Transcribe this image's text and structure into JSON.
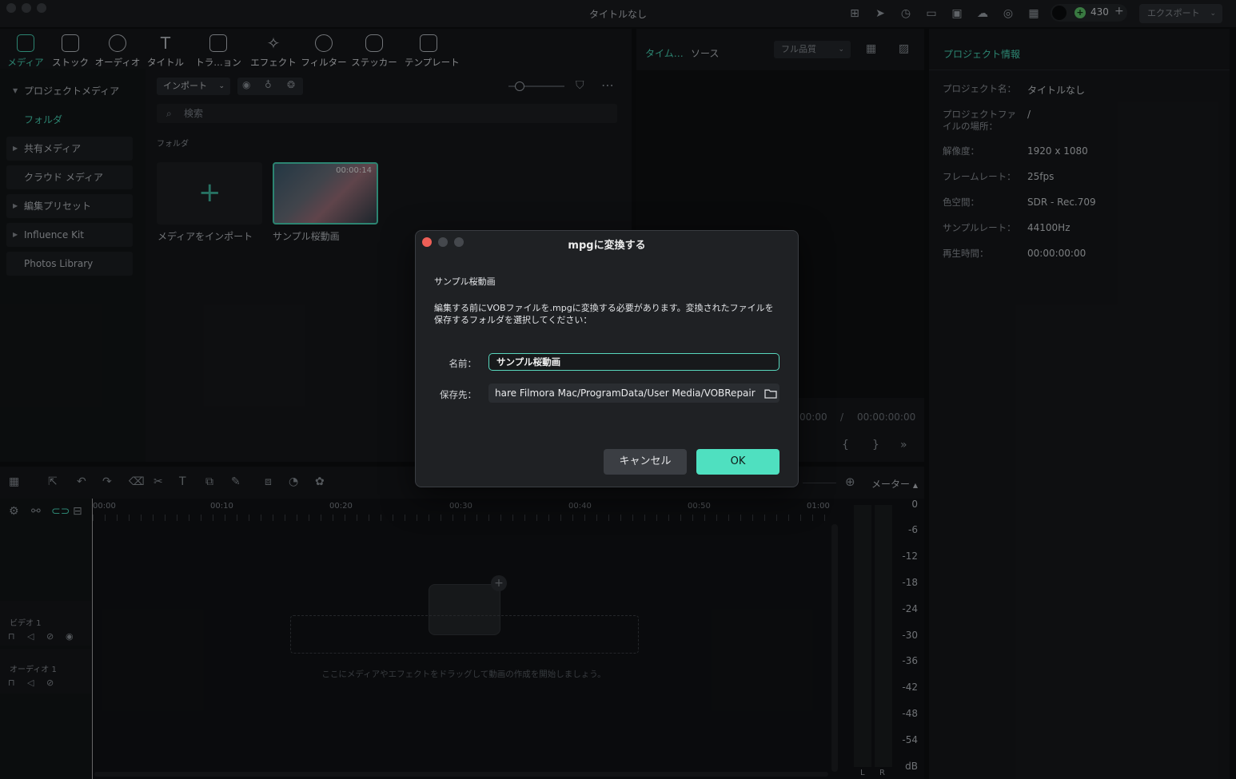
{
  "app": {
    "title": "タイトルなし",
    "credits": "430",
    "export_label": "エクスポート"
  },
  "toolbar": {
    "items": [
      {
        "label": "メディア"
      },
      {
        "label": "ストック"
      },
      {
        "label": "オーディオ"
      },
      {
        "label": "タイトル"
      },
      {
        "label": "トラ…ョン"
      },
      {
        "label": "エフェクト"
      },
      {
        "label": "フィルター"
      },
      {
        "label": "ステッカー"
      },
      {
        "label": "テンプレート"
      }
    ]
  },
  "sidebar": {
    "items": [
      {
        "label": "プロジェクトメディア"
      },
      {
        "label": "フォルダ"
      },
      {
        "label": "共有メディア"
      },
      {
        "label": "クラウド メディア"
      },
      {
        "label": "編集プリセット"
      },
      {
        "label": "Influence Kit"
      },
      {
        "label": "Photos Library"
      }
    ]
  },
  "media": {
    "import_label": "インポート",
    "search_placeholder": "検索",
    "folder_heading": "フォルダ",
    "import_tile_label": "メディアをインポート",
    "clip_label": "サンプル桜動画",
    "clip_duration": "00:00:14"
  },
  "preview": {
    "tab_timeline": "タイム…",
    "tab_source": "ソース",
    "quality": "フル品質",
    "time_current": "00:00",
    "time_separator": "/",
    "time_total": "00:00:00:00"
  },
  "project_info": {
    "title": "プロジェクト情報",
    "rows": [
      {
        "label": "プロジェクト名：",
        "value": "タイトルなし"
      },
      {
        "label": "プロジェクトファイルの場所：",
        "value": "/"
      },
      {
        "label": "解像度：",
        "value": "1920 x 1080"
      },
      {
        "label": "フレームレート：",
        "value": "25fps"
      },
      {
        "label": "色空間：",
        "value": "SDR - Rec.709"
      },
      {
        "label": "サンプルレート：",
        "value": "44100Hz"
      },
      {
        "label": "再生時間：",
        "value": "00:00:00:00"
      }
    ]
  },
  "timeline": {
    "ruler": [
      "00:00",
      "00:10",
      "00:20",
      "00:30",
      "00:40",
      "00:50",
      "01:00"
    ],
    "track_video": "ビデオ 1",
    "track_audio": "オーディオ 1",
    "drop_hint": "ここにメディアやエフェクトをドラッグして動画の作成を開始しましょう。",
    "meter_title": "メーター",
    "meter_scale": [
      "0",
      "-6",
      "-12",
      "-18",
      "-24",
      "-30",
      "-36",
      "-42",
      "-48",
      "-54",
      "dB"
    ],
    "meter_left": "L",
    "meter_right": "R"
  },
  "dialog": {
    "title": "mpgに変換する",
    "file_name": "サンプル桜動画",
    "message": "編集する前にVOBファイルを.mpgに変換する必要があります。変換されたファイルを保存するフォルダを選択してください：",
    "name_label": "名前：",
    "name_value": "サンプル桜動画",
    "dest_label": "保存先：",
    "dest_path": "hare Filmora Mac/ProgramData/User Media/VOBRepair",
    "cancel_label": "キャンセル",
    "ok_label": "OK"
  }
}
